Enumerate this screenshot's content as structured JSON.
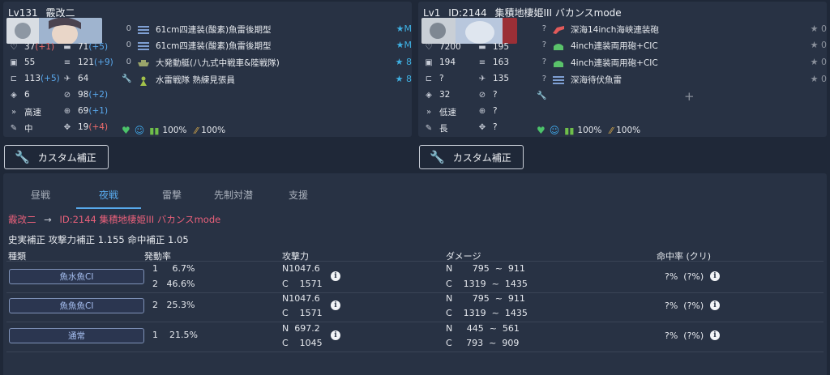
{
  "left_ship": {
    "level": "Lv131",
    "name": "霰改二",
    "stats": [
      {
        "icon": "hp-icon",
        "base": "37",
        "mod": "(+1)",
        "mod_class": "neg"
      },
      {
        "icon": "firepower-icon",
        "base": "71",
        "mod": "(+5)",
        "mod_class": "pos"
      },
      {
        "icon": "armor-icon",
        "base": "55",
        "mod": "",
        "mod_class": ""
      },
      {
        "icon": "torpedo-icon",
        "base": "121",
        "mod": "(+9)",
        "mod_class": "pos"
      },
      {
        "icon": "evasion-icon",
        "base": "113",
        "mod": "(+5)",
        "mod_class": "pos"
      },
      {
        "icon": "aa-icon",
        "base": "64",
        "mod": "",
        "mod_class": ""
      },
      {
        "icon": "aircraft-icon",
        "base": "6",
        "mod": "",
        "mod_class": ""
      },
      {
        "icon": "asw-icon",
        "base": "98",
        "mod": "(+2)",
        "mod_class": "pos"
      },
      {
        "icon": "speed-icon",
        "base": "高速",
        "mod": "",
        "mod_class": ""
      },
      {
        "icon": "los-icon",
        "base": "69",
        "mod": "(+1)",
        "mod_class": "pos"
      },
      {
        "icon": "range-icon",
        "base": "中",
        "mod": "",
        "mod_class": ""
      },
      {
        "icon": "luck-icon",
        "base": "19",
        "mod": "(+4)",
        "mod_class": "neg"
      }
    ],
    "equipment": [
      {
        "slot": "0",
        "name": "61cm四連装(酸素)魚雷後期型",
        "stars": "★M"
      },
      {
        "slot": "0",
        "name": "61cm四連装(酸素)魚雷後期型",
        "stars": "★M"
      },
      {
        "slot": "0",
        "name": "大発動艇(八九式中戦車&陸戦隊)",
        "stars": "★ 8"
      },
      {
        "slot": "",
        "name": "水雷戦隊 熟練見張員",
        "stars": "★ 8"
      }
    ],
    "condition": {
      "fuel": "100%",
      "ammo": "100%"
    }
  },
  "right_ship": {
    "level": "Lv1",
    "id": "ID:2144",
    "name": "集積地棲姫III バカンスmode",
    "stats": [
      {
        "icon": "hp-icon",
        "base": "7200",
        "mod": "",
        "mod_class": ""
      },
      {
        "icon": "firepower-icon",
        "base": "195",
        "mod": "",
        "mod_class": ""
      },
      {
        "icon": "armor-icon",
        "base": "194",
        "mod": "",
        "mod_class": ""
      },
      {
        "icon": "torpedo-icon",
        "base": "163",
        "mod": "",
        "mod_class": ""
      },
      {
        "icon": "evasion-icon",
        "base": "?",
        "mod": "",
        "mod_class": ""
      },
      {
        "icon": "aa-icon",
        "base": "135",
        "mod": "",
        "mod_class": ""
      },
      {
        "icon": "aircraft-icon",
        "base": "32",
        "mod": "",
        "mod_class": ""
      },
      {
        "icon": "asw-icon",
        "base": "?",
        "mod": "",
        "mod_class": ""
      },
      {
        "icon": "speed-icon",
        "base": "低速",
        "mod": "",
        "mod_class": ""
      },
      {
        "icon": "los-icon",
        "base": "?",
        "mod": "",
        "mod_class": ""
      },
      {
        "icon": "range-icon",
        "base": "長",
        "mod": "",
        "mod_class": ""
      },
      {
        "icon": "luck-icon",
        "base": "?",
        "mod": "",
        "mod_class": ""
      }
    ],
    "equipment": [
      {
        "slot": "?",
        "name": "深海14inch海峡連装砲",
        "stars": "★ 0"
      },
      {
        "slot": "?",
        "name": "4inch連装両用砲+CIC",
        "stars": "★ 0"
      },
      {
        "slot": "?",
        "name": "4inch連装両用砲+CIC",
        "stars": "★ 0"
      },
      {
        "slot": "?",
        "name": "深海待伏魚雷",
        "stars": "★ 0"
      }
    ],
    "condition": {
      "fuel": "100%",
      "ammo": "100%"
    }
  },
  "buttons": {
    "custom_left": "カスタム補正",
    "custom_right": "カスタム補正"
  },
  "tabs": [
    "昼戦",
    "夜戦",
    "雷撃",
    "先制対潜",
    "支援"
  ],
  "active_tab": "夜戦",
  "matchup": {
    "attacker": "霰改二",
    "arrow": "→",
    "defender": "ID:2144 集積地棲姫III バカンスmode"
  },
  "modifier_text": "史実補正 攻撃力補正 1.155 命中補正 1.05",
  "columns": {
    "type": "種類",
    "rate": "発動率",
    "power": "攻撃力",
    "damage": "ダメージ",
    "hit": "命中率 (クリ)"
  },
  "rows": [
    {
      "type": "魚水魚CI",
      "rates": [
        "1     6.7%",
        "2   46.6%"
      ],
      "power": [
        "N1047.6",
        "C    1571"
      ],
      "damage": [
        "N       795  ~  911",
        "C    1319  ~  1435"
      ],
      "hit": "?%  (?%)"
    },
    {
      "type": "魚魚魚CI",
      "rates": [
        "2   25.3%"
      ],
      "power": [
        "N1047.6",
        "C    1571"
      ],
      "damage": [
        "N       795  ~  911",
        "C    1319  ~  1435"
      ],
      "hit": "?%  (?%)"
    },
    {
      "type": "通常",
      "rates": [
        "1    21.5%"
      ],
      "power": [
        "N  697.2",
        "C    1045"
      ],
      "damage": [
        "N     445  ~  561",
        "C     793  ~  909"
      ],
      "hit": "?%  (?%)"
    }
  ],
  "colors": {
    "accent": "#58a9ec",
    "defender_name": "#e8607a",
    "star": "#3fb1e3",
    "positive": "#5aa9ee",
    "negative": "#ee6b6b"
  }
}
